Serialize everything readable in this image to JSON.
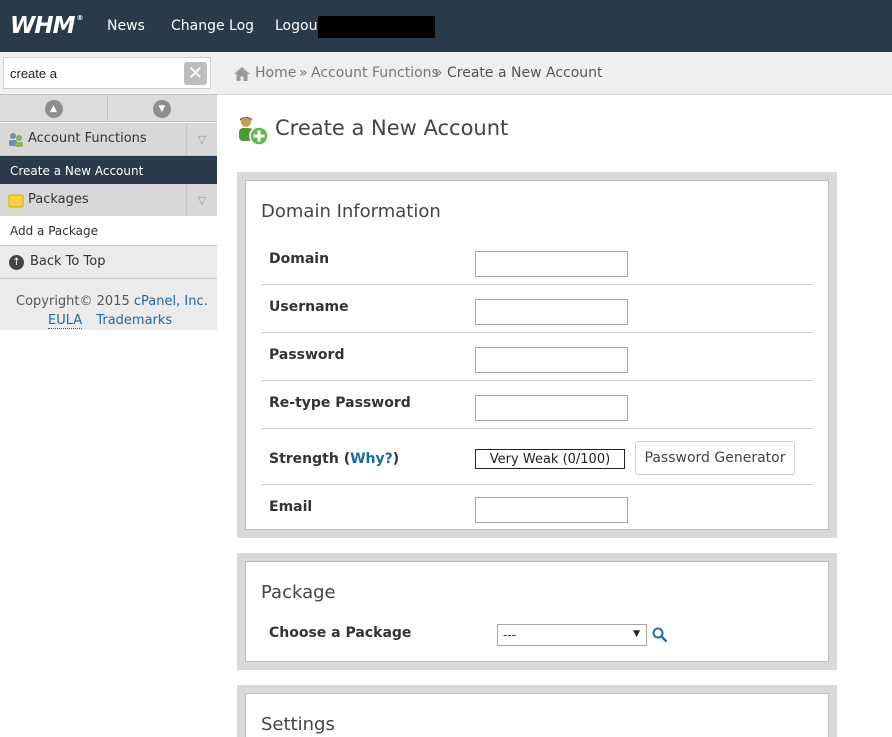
{
  "topbar": {
    "logo": "WHM",
    "nav": [
      "News",
      "Change Log",
      "Logout"
    ]
  },
  "sidebar": {
    "search": {
      "value": "create a",
      "placeholder": ""
    },
    "categories": [
      {
        "label": "Account Functions",
        "items": [
          "Create a New Account"
        ]
      },
      {
        "label": "Packages",
        "items": [
          "Add a Package"
        ]
      }
    ],
    "back_to_top": "Back To Top",
    "copyright_prefix": "Copyright© 2015",
    "copyright_company": "cPanel, Inc.",
    "eula": "EULA",
    "trademarks": "Trademarks"
  },
  "breadcrumb": {
    "home": "Home",
    "sep1": "»",
    "section": "Account Functions",
    "sep2": "»",
    "current": "Create a New Account"
  },
  "page": {
    "title": "Create a New Account"
  },
  "domain_info": {
    "title": "Domain Information",
    "domain_label": "Domain",
    "username_label": "Username",
    "password_label": "Password",
    "retype_label": "Re-type Password",
    "strength_label": "Strength (",
    "strength_why": "Why?",
    "strength_close": ")",
    "strength_value": "Very Weak (0/100)",
    "password_generator": "Password Generator",
    "email_label": "Email"
  },
  "package": {
    "title": "Package",
    "choose_label": "Choose a Package",
    "selected": "---"
  },
  "settings": {
    "title": "Settings"
  },
  "colors": {
    "topbar": "#293a4a",
    "link": "#1c6aa6",
    "active_nav": "#293a4a"
  }
}
